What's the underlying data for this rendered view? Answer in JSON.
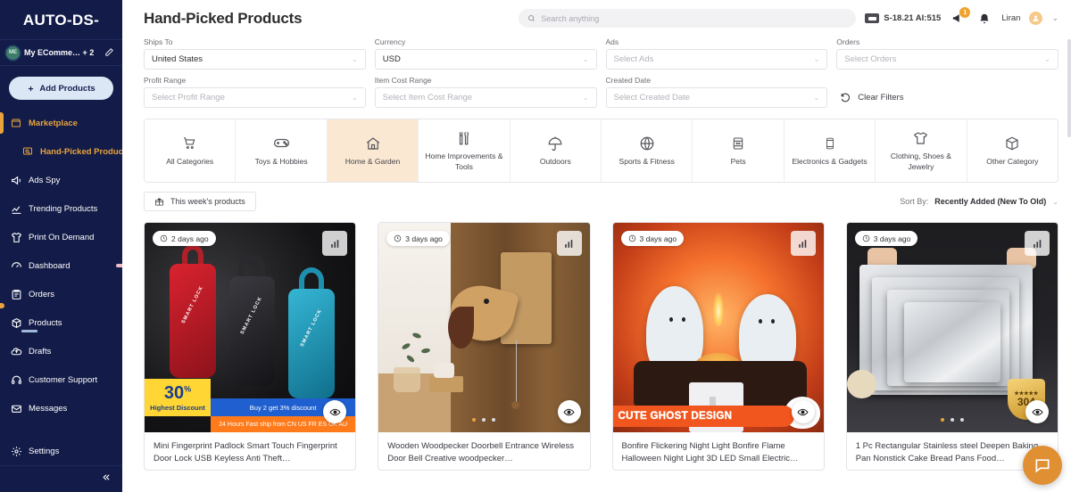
{
  "sidebar": {
    "logo": "AUTO-DS-",
    "account": {
      "initials": "ME",
      "name": "My EComme… + 2",
      "edit_icon": "pencil-icon"
    },
    "add_products_label": "Add Products",
    "items": [
      {
        "label": "Marketplace",
        "icon": "store-icon",
        "style": "accent"
      },
      {
        "label": "Hand-Picked Products",
        "icon": "hand-pick-icon",
        "style": "accent-sub"
      },
      {
        "label": "Ads Spy",
        "icon": "megaphone-icon",
        "style": "plain"
      },
      {
        "label": "Trending Products",
        "icon": "trending-chart-icon",
        "style": "plain"
      },
      {
        "label": "Print On Demand",
        "icon": "tshirt-icon",
        "style": "plain"
      },
      {
        "label": "Dashboard",
        "icon": "gauge-icon",
        "style": "plain"
      },
      {
        "label": "Orders",
        "icon": "clipboard-icon",
        "style": "plain"
      },
      {
        "label": "Products",
        "icon": "box-icon",
        "style": "plain"
      },
      {
        "label": "Drafts",
        "icon": "cloud-upload-icon",
        "style": "plain"
      },
      {
        "label": "Customer Support",
        "icon": "headset-icon",
        "style": "plain"
      },
      {
        "label": "Messages",
        "icon": "envelope-icon",
        "style": "plain"
      }
    ],
    "settings_label": "Settings",
    "collapse_icon": "double-chevron-left-icon"
  },
  "header": {
    "title": "Hand-Picked Products",
    "search_placeholder": "Search anything",
    "search_value": "",
    "credits": "S-18.21  AI:515",
    "notification_count": "1",
    "user_name": "Liran"
  },
  "filters": {
    "ships_to": {
      "label": "Ships To",
      "value": "United States",
      "placeholder": ""
    },
    "currency": {
      "label": "Currency",
      "value": "USD",
      "placeholder": ""
    },
    "ads": {
      "label": "Ads",
      "value": "",
      "placeholder": "Select Ads"
    },
    "orders": {
      "label": "Orders",
      "value": "",
      "placeholder": "Select Orders"
    },
    "profit_range": {
      "label": "Profit Range",
      "value": "",
      "placeholder": "Select Profit Range"
    },
    "item_cost_range": {
      "label": "Item Cost Range",
      "value": "",
      "placeholder": "Select Item Cost Range"
    },
    "created_date": {
      "label": "Created Date",
      "value": "",
      "placeholder": "Select Created Date"
    },
    "clear_label": "Clear Filters"
  },
  "categories": [
    {
      "label": "All Categories",
      "icon": "cart-icon",
      "active": false
    },
    {
      "label": "Toys & Hobbies",
      "icon": "gamepad-icon",
      "active": false
    },
    {
      "label": "Home & Garden",
      "icon": "house-icon",
      "active": true
    },
    {
      "label": "Home Improvements & Tools",
      "icon": "tools-icon",
      "active": false
    },
    {
      "label": "Outdoors",
      "icon": "umbrella-icon",
      "active": false
    },
    {
      "label": "Sports & Fitness",
      "icon": "basketball-icon",
      "active": false
    },
    {
      "label": "Pets",
      "icon": "pet-food-icon",
      "active": false
    },
    {
      "label": "Electronics & Gadgets",
      "icon": "phone-icon",
      "active": false
    },
    {
      "label": "Clothing, Shoes & Jewelry",
      "icon": "tshirt-icon",
      "active": false
    },
    {
      "label": "Other Category",
      "icon": "box-icon",
      "active": false
    }
  ],
  "toolbar": {
    "week_button": "This week's products",
    "sort_label": "Sort By:",
    "sort_value": "Recently Added (New To Old)"
  },
  "products": [
    {
      "time_badge": "2 days ago",
      "title": "Mini Fingerprint Padlock Smart Touch Fingerprint Door Lock USB Keyless Anti Theft…",
      "overlay": {
        "discount_value": "30",
        "discount_unit": "%",
        "discount_label": "Highest Discount",
        "promo_blue": "Buy 2 get 3% discount",
        "promo_orange": "24 Hours Fast ship from CN US FR ES UK AU",
        "product_text": "SMART LOCK"
      }
    },
    {
      "time_badge": "3 days ago",
      "title": "Wooden Woodpecker Doorbell Entrance Wireless Door Bell Creative woodpecker…",
      "dots": 3,
      "active_dot": 0
    },
    {
      "time_badge": "3 days ago",
      "title": "Bonfire Flickering Night Light Bonfire Flame Halloween Night Light 3D LED Small Electric…",
      "overlay": {
        "ribbon": "CUTE GHOST DESIGN"
      }
    },
    {
      "time_badge": "3 days ago",
      "title": "1 Pc Rectangular Stainless steel Deepen Baking Pan Nonstick Cake Bread Pans Food…",
      "overlay": {
        "medal_number": "304"
      },
      "dots": 3,
      "active_dot": 0
    }
  ],
  "colors": {
    "sidebar_bg": "#131c48",
    "accent": "#e8a33d",
    "active_tab_bg": "#fbe8d2",
    "chat_fab": "#e08f33"
  }
}
